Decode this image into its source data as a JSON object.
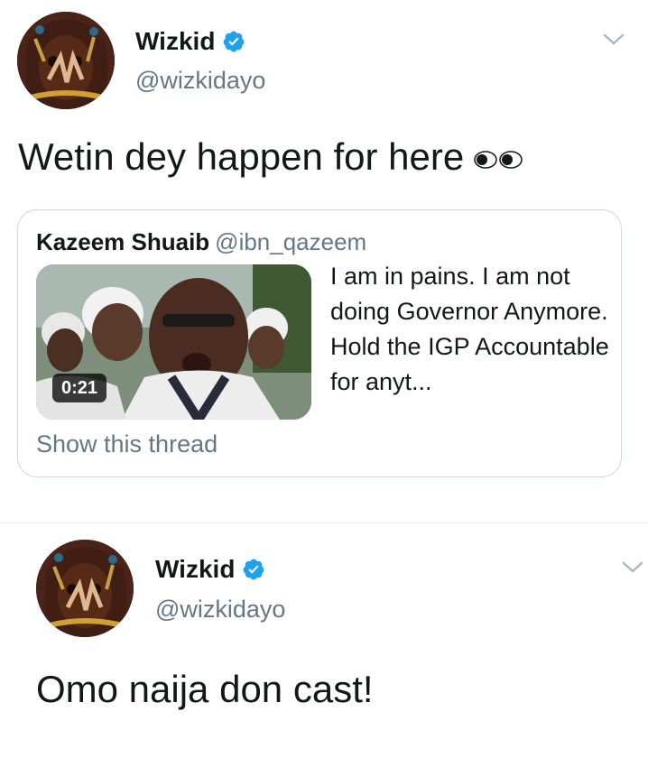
{
  "tweets": [
    {
      "author_name": "Wizkid",
      "author_handle": "@wizkidayo",
      "text": "Wetin dey happen for here",
      "quoted": {
        "author_name": "Kazeem Shuaib",
        "author_handle": "@ibn_qazeem",
        "video_duration": "0:21",
        "text": "I am in pains. I am not doing Governor Anymore. Hold the IGP Accountable for anyt...",
        "show_thread_label": "Show this thread"
      }
    },
    {
      "author_name": "Wizkid",
      "author_handle": "@wizkidayo",
      "text": "Omo naija don cast!"
    }
  ],
  "icons": {
    "verified": "verified-badge-icon",
    "menu": "chevron-down-icon",
    "emoji": "eyes-emoji-icon"
  },
  "colors": {
    "verified_blue": "#1da1f2",
    "secondary_text": "#657786",
    "border": "#ccd6dd"
  }
}
